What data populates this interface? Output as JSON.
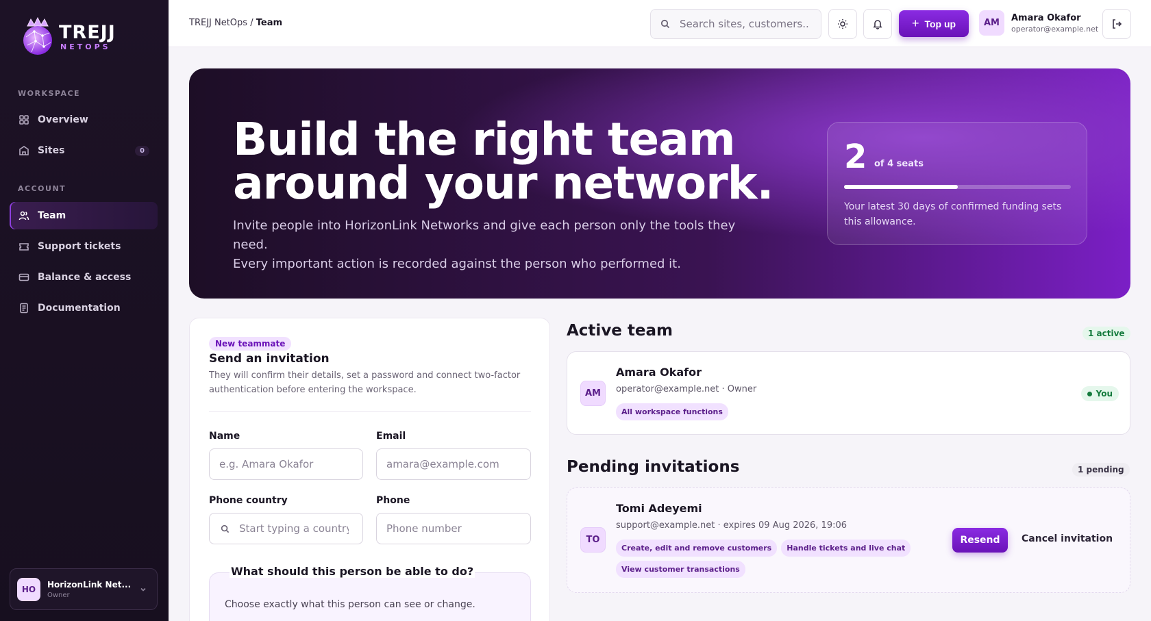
{
  "sidebar": {
    "brand": {
      "title": "TREJJ",
      "subtitle": "NETOPS"
    },
    "sections": [
      {
        "label": "WORKSPACE"
      },
      {
        "label": "ACCOUNT"
      }
    ],
    "items": [
      {
        "label": "Overview",
        "icon": "grid-icon"
      },
      {
        "label": "Sites",
        "icon": "building-icon",
        "badge": "0"
      },
      {
        "label": "Team",
        "icon": "users-icon",
        "active": true
      },
      {
        "label": "Support tickets",
        "icon": "ticket-icon"
      },
      {
        "label": "Balance & access",
        "icon": "card-icon"
      },
      {
        "label": "Documentation",
        "icon": "document-icon"
      }
    ],
    "org": {
      "initials": "HO",
      "name": "HorizonLink Net...",
      "role": "Owner"
    }
  },
  "header": {
    "breadcrumb_root": "TREJJ NetOps",
    "breadcrumb_sep": "/",
    "breadcrumb_current": "Team",
    "search_placeholder": "Search sites, customers...",
    "topup_label": "Top up",
    "user": {
      "initials": "AM",
      "name": "Amara Okafor",
      "email": "operator@example.net"
    }
  },
  "hero": {
    "title_line1": "Build the right team",
    "title_line2": "around your network.",
    "desc_line1": "Invite people into HorizonLink Networks and give each person only the tools they need.",
    "desc_line2": "Every important action is recorded against the person who performed it.",
    "seats_used": "2",
    "seats_of": "of 4 seats",
    "seat_fraction": 0.5,
    "seat_note": "Your latest 30 days of confirmed funding sets this allowance."
  },
  "invite_form": {
    "tag": "New teammate",
    "title": "Send an invitation",
    "subtitle": "They will confirm their details, set a password and connect two-factor authentication before entering the workspace.",
    "name_label": "Name",
    "name_placeholder": "e.g. Amara Okafor",
    "email_label": "Email",
    "email_placeholder": "amara@example.com",
    "phone_country_label": "Phone country",
    "phone_country_placeholder": "Start typing a country",
    "phone_label": "Phone",
    "phone_placeholder": "Phone number",
    "permissions_title": "What should this person be able to do?",
    "permissions_desc": "Choose exactly what this person can see or change."
  },
  "active_team": {
    "title": "Active team",
    "badge": "1 active",
    "members": [
      {
        "initials": "AM",
        "name": "Amara Okafor",
        "meta": "operator@example.net · Owner",
        "chips": [
          "All workspace functions"
        ],
        "status": "You"
      }
    ]
  },
  "pending": {
    "title": "Pending invitations",
    "badge": "1 pending",
    "invites": [
      {
        "initials": "TO",
        "name": "Tomi Adeyemi",
        "meta": "support@example.net · expires 09 Aug 2026, 19:06",
        "chips": [
          "Create, edit and remove customers",
          "Handle tickets and live chat",
          "View customer transactions"
        ],
        "resend_label": "Resend",
        "cancel_label": "Cancel invitation"
      }
    ]
  },
  "colors": {
    "accent": "#6a12b8",
    "sidebar_bg": "#1d1226",
    "success": "#137a3c"
  }
}
